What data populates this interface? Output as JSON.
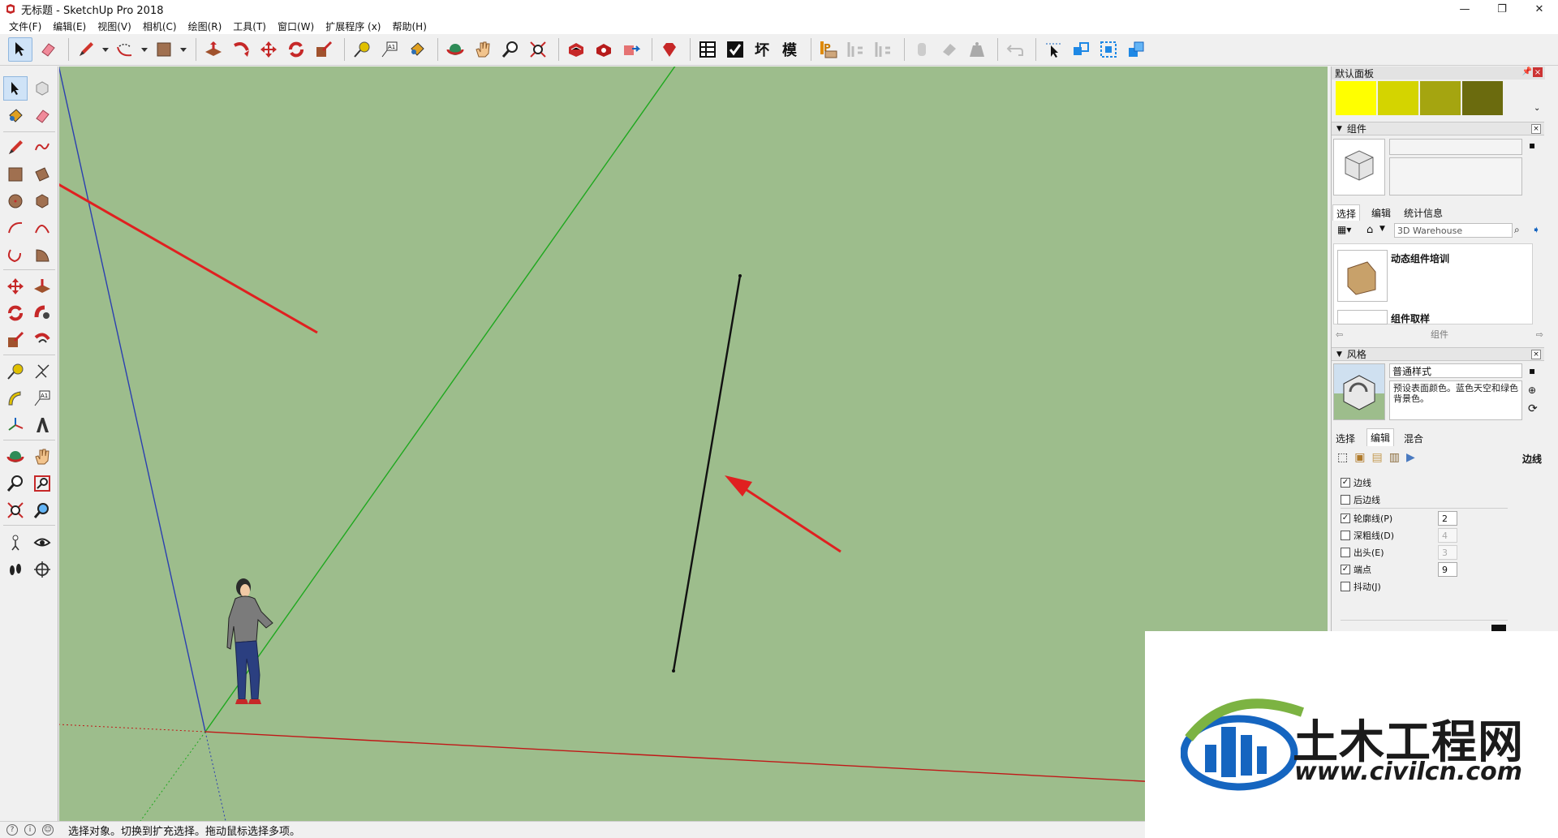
{
  "window": {
    "title": "无标题 - SketchUp Pro 2018",
    "controls": [
      "—",
      "❐",
      "✕"
    ]
  },
  "menu": [
    "文件(F)",
    "编辑(E)",
    "视图(V)",
    "相机(C)",
    "绘图(R)",
    "工具(T)",
    "窗口(W)",
    "扩展程序 (x)",
    "帮助(H)"
  ],
  "toolbar": {
    "text_buttons": [
      "坏",
      "模"
    ]
  },
  "tray": {
    "title": "默认面板",
    "swatches": [
      "#ffff00",
      "#d4d400",
      "#a5a510",
      "#6b6b0e"
    ],
    "components": {
      "header": "组件",
      "tabs": [
        "选择",
        "编辑",
        "统计信息"
      ],
      "search_placeholder": "3D Warehouse",
      "items": [
        "动态组件培训",
        "组件取样"
      ],
      "footer_label": "组件"
    },
    "styles": {
      "header": "风格",
      "style_name": "普通样式",
      "style_desc": "预设表面颜色。蓝色天空和绿色背景色。",
      "tabs": [
        "选择",
        "编辑",
        "混合"
      ],
      "section_label": "边线",
      "edge_settings": [
        {
          "label": "边线",
          "checked": true
        },
        {
          "label": "后边线",
          "checked": false
        },
        {
          "label": "轮廓线(P)",
          "checked": true,
          "value": "2",
          "enabled": true
        },
        {
          "label": "深粗线(D)",
          "checked": false,
          "value": "4",
          "enabled": false
        },
        {
          "label": "出头(E)",
          "checked": false,
          "value": "3",
          "enabled": false
        },
        {
          "label": "端点",
          "checked": true,
          "value": "9",
          "enabled": true
        },
        {
          "label": "抖动(J)",
          "checked": false
        }
      ]
    }
  },
  "watermark": {
    "name": "土木工程网",
    "url": "www.civilcn.com"
  },
  "status": {
    "message": "选择对象。切换到扩充选择。拖动鼠标选择多项。"
  }
}
